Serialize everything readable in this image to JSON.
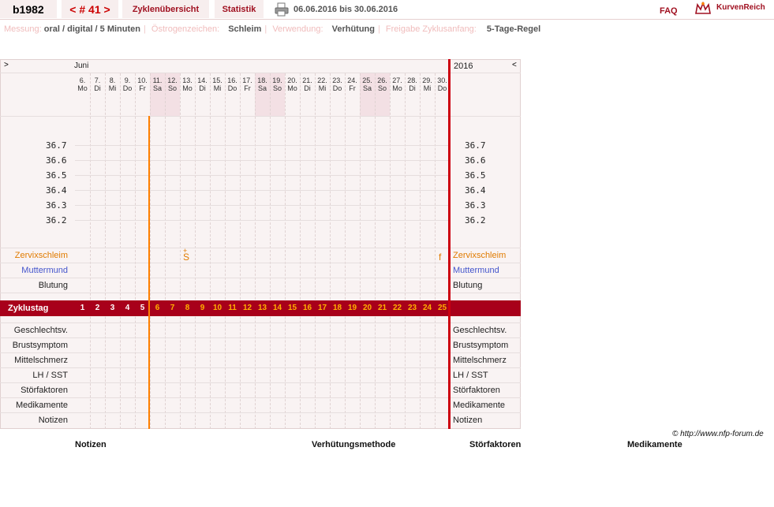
{
  "header": {
    "user": "b1982",
    "cycle": "< # 41 >",
    "tabs": [
      "Zyklenübersicht",
      "Statistik"
    ],
    "date_range": "06.06.2016 bis 30.06.2016",
    "faq": "FAQ",
    "brand": "KurvenReich"
  },
  "info": {
    "messung_label": "Messung:",
    "messung": "oral / digital / 5 Minuten",
    "oestrogen_label": "Östrogenzeichen:",
    "oestrogen": "Schleim",
    "verwendung_label": "Verwendung:",
    "verwendung": "Verhütung",
    "freigabe_label": "Freigabe Zyklusanfang:",
    "freigabe": "5-Tage-Regel"
  },
  "chart": {
    "nav_prev": ">",
    "nav_next": "<",
    "month": "Juni",
    "year": "2016",
    "days": [
      {
        "d": "6.",
        "w": "Mo"
      },
      {
        "d": "7.",
        "w": "Di"
      },
      {
        "d": "8.",
        "w": "Mi"
      },
      {
        "d": "9.",
        "w": "Do"
      },
      {
        "d": "10.",
        "w": "Fr"
      },
      {
        "d": "11.",
        "w": "Sa"
      },
      {
        "d": "12.",
        "w": "So"
      },
      {
        "d": "13.",
        "w": "Mo"
      },
      {
        "d": "14.",
        "w": "Di"
      },
      {
        "d": "15.",
        "w": "Mi"
      },
      {
        "d": "16.",
        "w": "Do"
      },
      {
        "d": "17.",
        "w": "Fr"
      },
      {
        "d": "18.",
        "w": "Sa"
      },
      {
        "d": "19.",
        "w": "So"
      },
      {
        "d": "20.",
        "w": "Mo"
      },
      {
        "d": "21.",
        "w": "Di"
      },
      {
        "d": "22.",
        "w": "Mi"
      },
      {
        "d": "23.",
        "w": "Do"
      },
      {
        "d": "24.",
        "w": "Fr"
      },
      {
        "d": "25.",
        "w": "Sa"
      },
      {
        "d": "26.",
        "w": "So"
      },
      {
        "d": "27.",
        "w": "Mo"
      },
      {
        "d": "28.",
        "w": "Di"
      },
      {
        "d": "29.",
        "w": "Mi"
      },
      {
        "d": "30.",
        "w": "Do"
      }
    ],
    "temps": [
      "36.7",
      "36.6",
      "36.5",
      "36.4",
      "36.3",
      "36.2"
    ],
    "rows_top": [
      "Zervixschleim",
      "Muttermund",
      "Blutung"
    ],
    "cycle_label": "Zyklustag",
    "cycle_days": [
      "1",
      "2",
      "3",
      "4",
      "5",
      "6",
      "7",
      "8",
      "9",
      "10",
      "11",
      "12",
      "13",
      "14",
      "15",
      "16",
      "17",
      "18",
      "19",
      "20",
      "21",
      "22",
      "23",
      "24",
      "25"
    ],
    "rows_bottom": [
      "Geschlechtsv.",
      "Brustsymptom",
      "Mittelschmerz",
      "LH / SST",
      "Störfaktoren",
      "Medikamente",
      "Notizen"
    ],
    "mucus_marks": [
      {
        "day": 8,
        "symbol": "S",
        "mark": "+"
      },
      {
        "day": 25,
        "symbol": "f"
      }
    ],
    "copyright": "© http://www.nfp-forum.de"
  },
  "footer": {
    "notizen": "Notizen",
    "methode": "Verhütungsmethode",
    "stoerfaktoren": "Störfaktoren",
    "medikamente": "Medikamente"
  },
  "colors": {
    "accent": "#a8001a",
    "orange": "#ff8000",
    "blue": "#4455cc",
    "weekend": "#f3e0e4"
  }
}
